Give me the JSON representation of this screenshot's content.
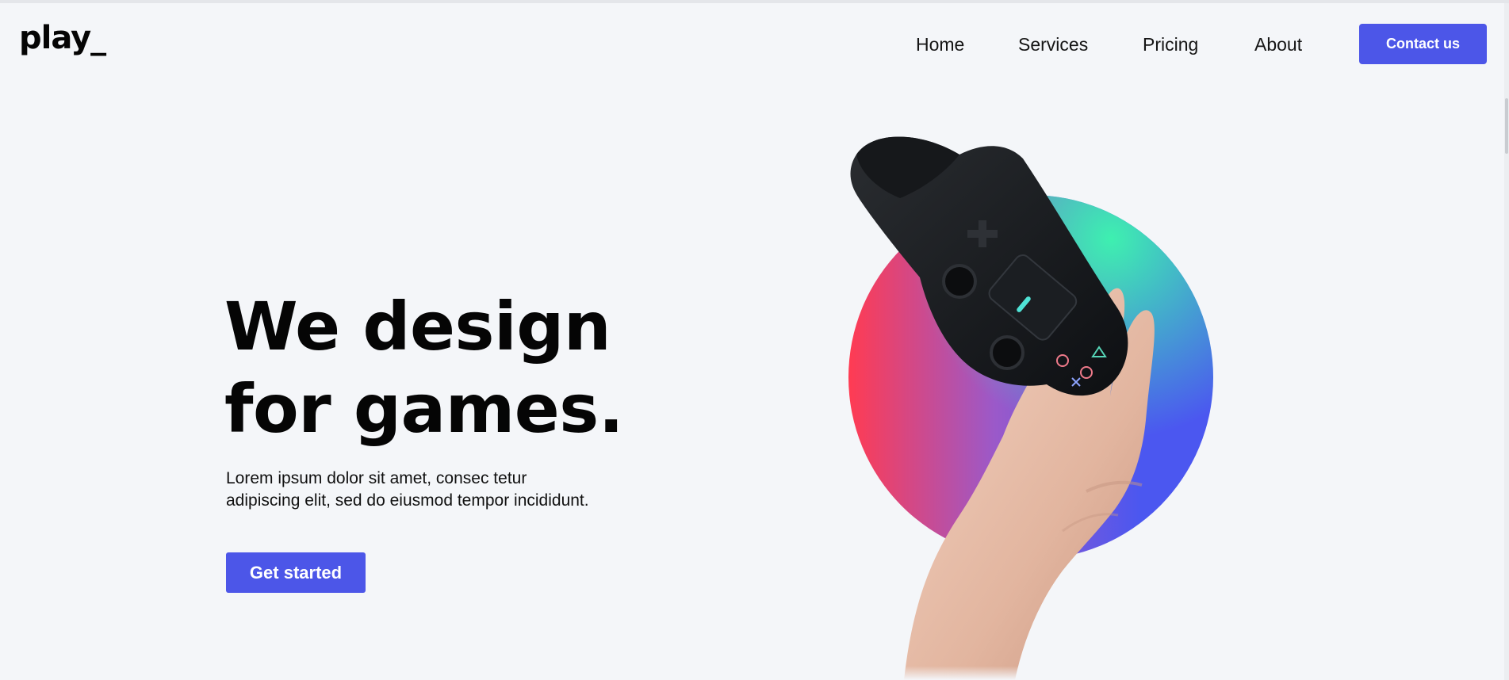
{
  "header": {
    "logo": "play_",
    "nav": [
      {
        "label": "Home"
      },
      {
        "label": "Services"
      },
      {
        "label": "Pricing"
      },
      {
        "label": "About"
      }
    ],
    "contact_label": "Contact us"
  },
  "hero": {
    "title_line1": "We design",
    "title_line2": "for games.",
    "description_line1": "Lorem ipsum dolor sit amet, consec tetur",
    "description_line2": "adipiscing elit, sed do eiusmod tempor incididunt.",
    "cta_label": "Get started"
  },
  "illustration": {
    "icon": "gamepad-in-hand-icon",
    "circle_gradient_colors": [
      "#ff3b52",
      "#9b59c9",
      "#4b57f0",
      "#3ef0b0"
    ]
  },
  "colors": {
    "accent": "#4c56e8",
    "background": "#f4f6f9",
    "text": "#050505"
  }
}
